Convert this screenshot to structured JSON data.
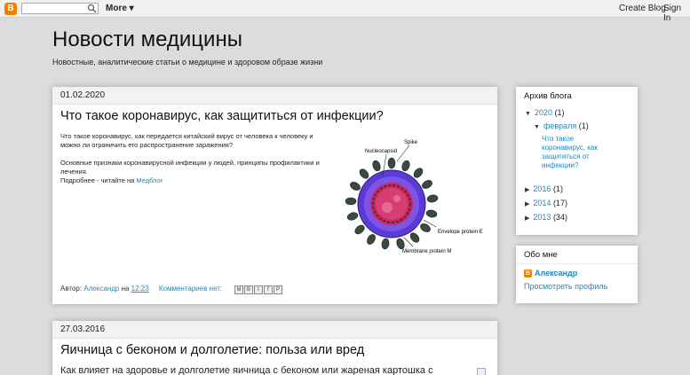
{
  "navbar": {
    "logo": "B",
    "more_label": "More ▾",
    "create_blog": "Create Blog",
    "sign_in": "Sign In"
  },
  "header": {
    "title": "Новости медицины",
    "description": "Новостные, аналитические статьи о медицине и здоровом образе жизни"
  },
  "posts": [
    {
      "date": "01.02.2020",
      "title": "Что такое коронавирус, как защититься от инфекции?",
      "paragraph1": "Что такое коронавирус, как передается китайский вирус от человека к человеку и можно ли ограничить его распространение заражения?",
      "paragraph2": "Основные признаки коронавирусной инфекции у людей, принципы профилактики и лечения.",
      "more_prefix": "Подробнее  - читайте на ",
      "more_link": "Медблог",
      "image_labels": {
        "spike": "Spike",
        "nucleocapsid": "Nucleocapsid",
        "envelope": "Envelope protein E",
        "membrane": "Membrane protein M"
      },
      "author_prefix": "Автор: ",
      "author": "Александр",
      "at": " на ",
      "time": "12:23",
      "comments": "Комментариев нет:",
      "share_icons": [
        "M",
        "B",
        "t",
        "f",
        "P"
      ]
    },
    {
      "date": "27.03.2016",
      "title": "Яичница с беконом и долголетие: польза или вред",
      "snippet": "Как влияет на здоровье и долголетие яичница с беконом или жареная картошка с"
    }
  ],
  "archive": {
    "title": "Архив блога",
    "years": [
      {
        "toggle": "▼",
        "year": "2020",
        "count": "(1)"
      },
      {
        "toggle": "▶",
        "year": "2016",
        "count": "(1)"
      },
      {
        "toggle": "▶",
        "year": "2014",
        "count": "(17)"
      },
      {
        "toggle": "▶",
        "year": "2013",
        "count": "(34)"
      }
    ],
    "month": {
      "toggle": "▼",
      "name": "февраля",
      "count": "(1)"
    },
    "post_link": "Что такое коронавирус, как защититься от инфекции?"
  },
  "about": {
    "title": "Обо мне",
    "name": "Александр",
    "profile_link": "Просмотреть профиль"
  },
  "colors": {
    "accent": "#2288bb",
    "blogger_orange": "#f57d00",
    "background": "#dcdcdc"
  }
}
